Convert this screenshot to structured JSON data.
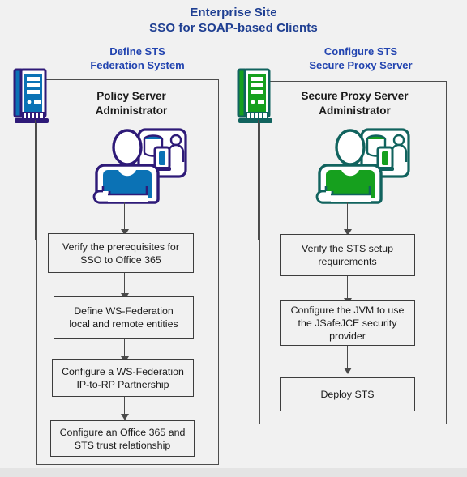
{
  "diagram": {
    "title_line1": "Enterprise Site",
    "title_line2": "SSO for SOAP-based Clients",
    "accent_title_color": "#1f3f92",
    "accent_heading_color": "#2244b0",
    "background_color": "#f1f1f1"
  },
  "columns": [
    {
      "id": "left",
      "heading_line1": "Define STS",
      "heading_line2": "Federation System",
      "admin_line1": "Policy Server",
      "admin_line2": "Administrator",
      "server_icon": "server-tower-icon",
      "person_icon": "administrator-person-icon",
      "theme_color": "#0b72b5",
      "outline_color": "#2e1a78",
      "steps": [
        {
          "line1": "Verify the prerequisites for",
          "line2": "SSO to Office 365",
          "line3": ""
        },
        {
          "line1": "Define WS-Federation",
          "line2": "local and remote entities",
          "line3": ""
        },
        {
          "line1": "Configure a WS-Federation",
          "line2": "IP-to-RP Partnership",
          "line3": ""
        },
        {
          "line1": "Configure an Office 365 and",
          "line2": "STS trust relationship",
          "line3": ""
        }
      ]
    },
    {
      "id": "right",
      "heading_line1": "Configure STS",
      "heading_line2": "Secure Proxy Server",
      "admin_line1": "Secure Proxy Server",
      "admin_line2": "Administrator",
      "server_icon": "server-tower-icon",
      "person_icon": "administrator-person-icon",
      "theme_color": "#16a01e",
      "outline_color": "#11635e",
      "steps": [
        {
          "line1": "Verify the STS setup",
          "line2": "requirements",
          "line3": ""
        },
        {
          "line1": "Configure the JVM to use",
          "line2": "the JSafeJCE security",
          "line3": "provider"
        },
        {
          "line1": "Deploy STS",
          "line2": "",
          "line3": ""
        }
      ]
    }
  ]
}
